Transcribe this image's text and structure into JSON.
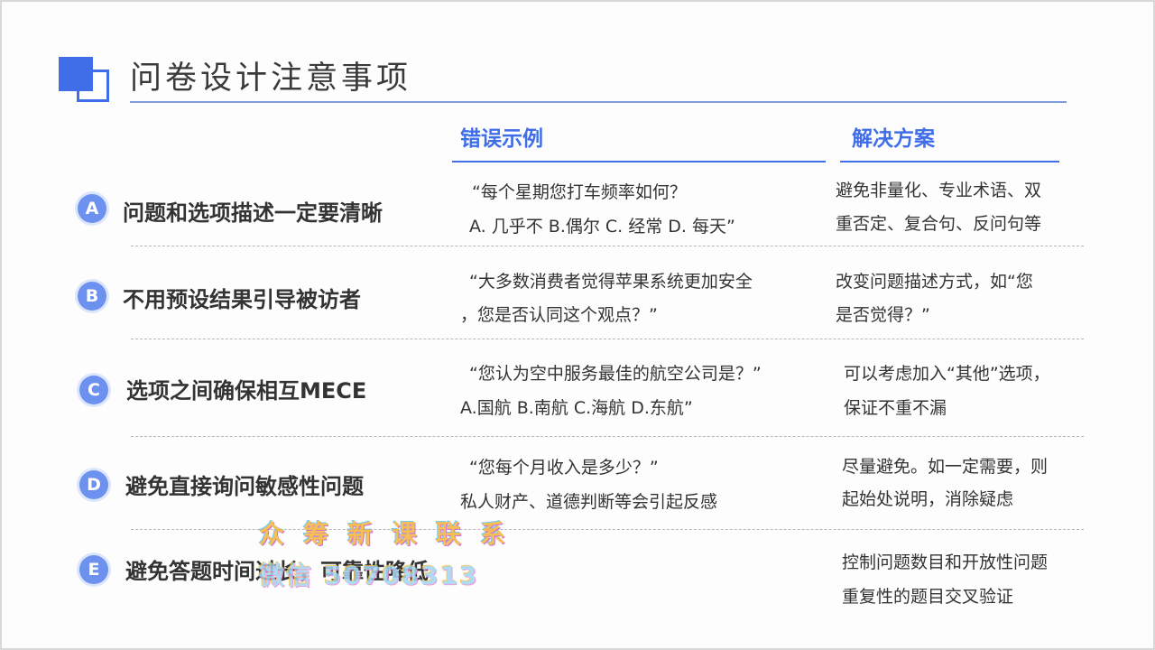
{
  "title": "问卷设计注意事项",
  "headers": {
    "errors": "错误示例",
    "solutions": "解决方案"
  },
  "rows": [
    {
      "badge": "A",
      "title": "问题和选项描述一定要清晰",
      "example": [
        "“每个星期您打车频率如何？",
        "A. 几乎不 B.偶尔 C. 经常 D. 每天”"
      ],
      "solution": [
        "避免非量化、专业术语、双",
        "重否定、复合句、反问句等"
      ]
    },
    {
      "badge": "B",
      "title": "不用预设结果引导被访者",
      "example": [
        "“大多数消费者觉得苹果系统更加安全",
        "，您是否认同这个观点？”"
      ],
      "solution": [
        "改变问题描述方式，如“您",
        "是否觉得？”"
      ]
    },
    {
      "badge": "C",
      "title": "选项之间确保相互MECE",
      "example": [
        "“您认为空中服务最佳的航空公司是？”",
        "A.国航 B.南航 C.海航 D.东航”"
      ],
      "solution": [
        "可以考虑加入“其他”选项，",
        "保证不重不漏"
      ]
    },
    {
      "badge": "D",
      "title": "避免直接询问敏感性问题",
      "example": [
        "“您每个月收入是多少？”",
        "私人财产、道德判断等会引起反感"
      ],
      "solution": [
        "尽量避免。如一定需要，则",
        "起始处说明，消除疑虑"
      ]
    },
    {
      "badge": "E",
      "title": "避免答题时间过长，可靠性降低",
      "example": [
        "",
        ""
      ],
      "solution": [
        "控制问题数目和开放性问题",
        "重复性的题目交叉验证"
      ]
    }
  ],
  "watermark": {
    "line1": "众筹新课联系",
    "line2": "微信 50708313"
  },
  "colors": {
    "accent": "#3f6ee8",
    "badge": "#6d91ee"
  }
}
